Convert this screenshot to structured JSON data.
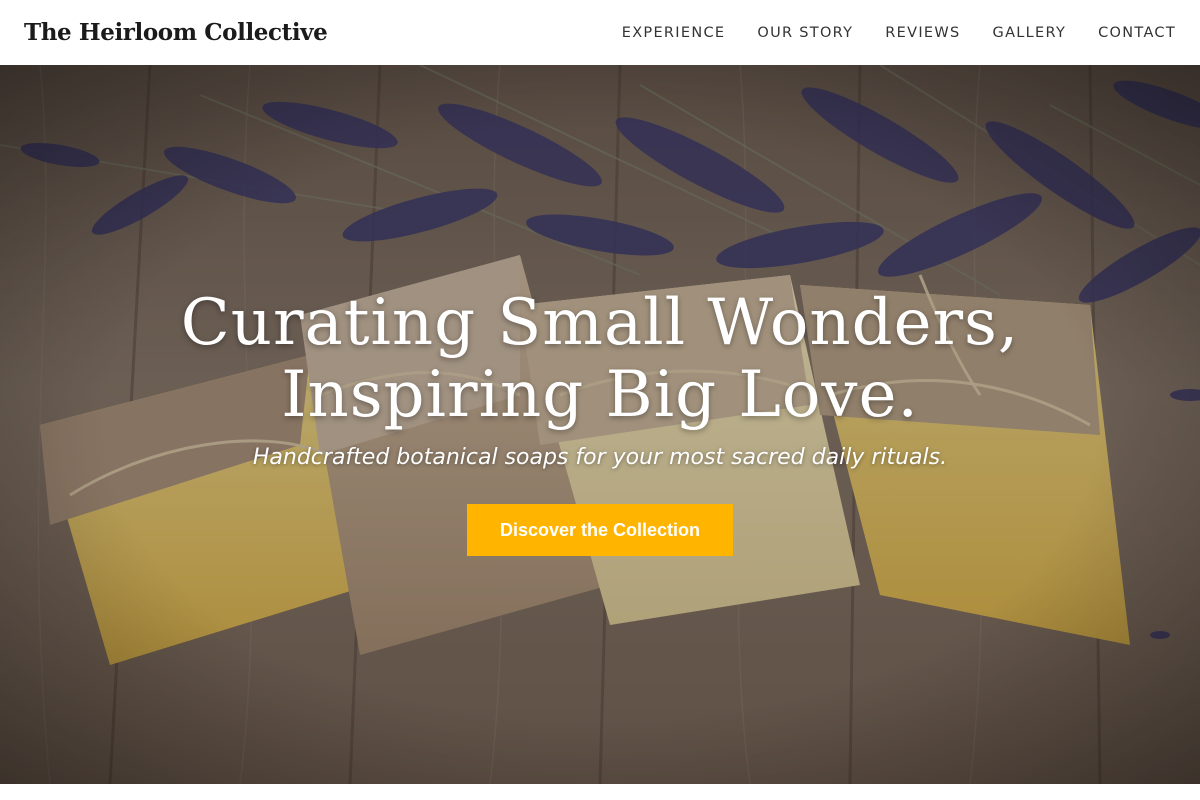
{
  "header": {
    "brand": "The Heirloom Collective",
    "nav": [
      "EXPERIENCE",
      "OUR STORY",
      "REVIEWS",
      "GALLERY",
      "CONTACT"
    ]
  },
  "hero": {
    "title_line1": "Curating Small Wonders,",
    "title_line2": "Inspiring Big Love.",
    "subtitle": "Handcrafted botanical soaps for your most sacred daily rituals.",
    "cta_label": "Discover the Collection",
    "image": "lavender-and-soap-bars-photo"
  },
  "colors": {
    "accent": "#ffb400",
    "header_bg": "#ffffff",
    "brand_text": "#1b1b1b"
  }
}
